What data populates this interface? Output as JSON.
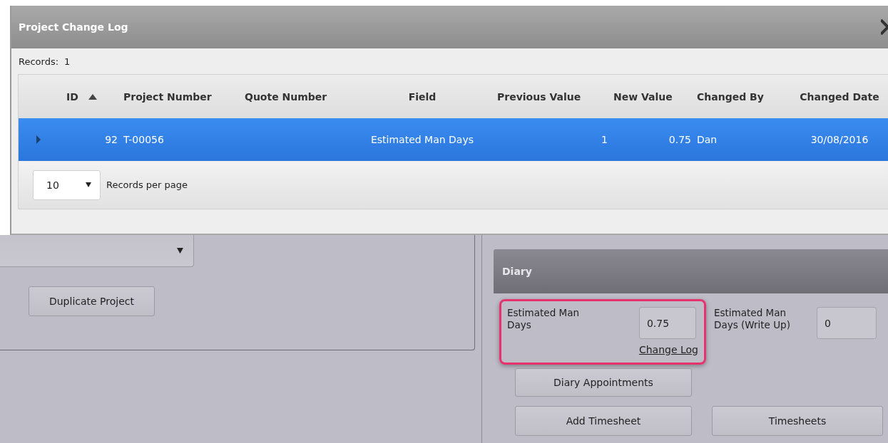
{
  "dialog": {
    "title": "Project Change Log",
    "records_label": "Records:",
    "records_count": "1",
    "table": {
      "columns": [
        {
          "label": "ID",
          "sorted": true
        },
        {
          "label": "Project Number",
          "sorted": false
        },
        {
          "label": "Quote Number",
          "sorted": false
        },
        {
          "label": "Field",
          "sorted": false
        },
        {
          "label": "Previous Value",
          "sorted": false
        },
        {
          "label": "New Value",
          "sorted": false
        },
        {
          "label": "Changed By",
          "sorted": false
        },
        {
          "label": "Changed Date",
          "sorted": false
        }
      ],
      "rows": [
        {
          "selected": true,
          "expanded": false,
          "cells": [
            "92",
            "T-00056",
            "",
            "Estimated Man Days",
            "1",
            "0.75",
            "Dan",
            "30/08/2016"
          ]
        }
      ]
    },
    "pager": {
      "page_size": "10",
      "label": "Records per page"
    }
  },
  "project_panel": {
    "buttons": [
      "Duplicate Project"
    ]
  },
  "diary": {
    "title": "Diary",
    "fields": [
      {
        "label": "Estimated Man Days",
        "value": "0.75",
        "link": "Change Log",
        "highlighted": true
      },
      {
        "label": "Estimated Man Days (Write Up)",
        "value": "0",
        "highlighted": false
      }
    ],
    "buttons": [
      "Diary Appointments",
      "Add Timesheet",
      "Timesheets"
    ]
  }
}
